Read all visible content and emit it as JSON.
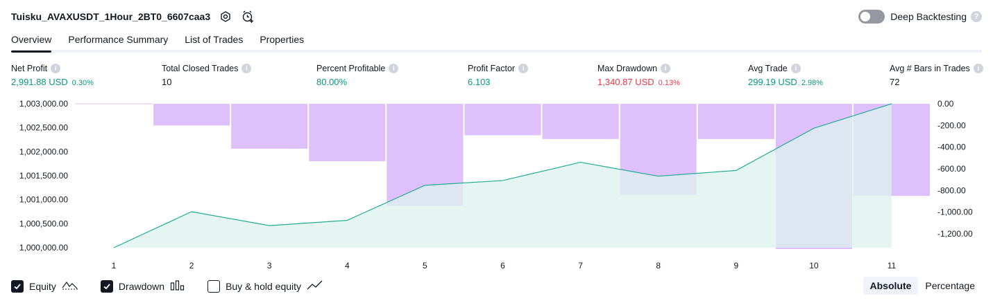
{
  "header": {
    "title": "Tuisku_AVAXUSDT_1Hour_2BT0_6607caa3",
    "deep_backtesting_label": "Deep Backtesting",
    "deep_backtesting_enabled": false,
    "help_glyph": "?"
  },
  "tabs": [
    {
      "label": "Overview",
      "active": true
    },
    {
      "label": "Performance Summary",
      "active": false
    },
    {
      "label": "List of Trades",
      "active": false
    },
    {
      "label": "Properties",
      "active": false
    }
  ],
  "metrics": [
    {
      "label": "Net Profit",
      "value": "2,991.88 USD",
      "pct": "0.30%",
      "color": "green"
    },
    {
      "label": "Total Closed Trades",
      "value": "10",
      "pct": "",
      "color": "dark"
    },
    {
      "label": "Percent Profitable",
      "value": "80.00%",
      "pct": "",
      "color": "green"
    },
    {
      "label": "Profit Factor",
      "value": "6.103",
      "pct": "",
      "color": "green"
    },
    {
      "label": "Max Drawdown",
      "value": "1,340.87 USD",
      "pct": "0.13%",
      "color": "red"
    },
    {
      "label": "Avg Trade",
      "value": "299.19 USD",
      "pct": "2.98%",
      "color": "green"
    },
    {
      "label": "Avg # Bars in Trades",
      "value": "72",
      "pct": "",
      "color": "dark"
    }
  ],
  "info_glyph": "i",
  "chart_data": {
    "type": "area",
    "x": [
      1,
      2,
      3,
      4,
      5,
      6,
      7,
      8,
      9,
      10,
      11
    ],
    "series": [
      {
        "name": "Equity",
        "type": "area",
        "axis": "left",
        "values": [
          1000000,
          1000750,
          1000460,
          1000570,
          1001300,
          1001400,
          1001780,
          1001490,
          1001610,
          1002490,
          1003000
        ]
      },
      {
        "name": "Drawdown",
        "type": "bar",
        "axis": "right",
        "values": [
          0,
          -200,
          -415,
          -530,
          -940,
          -290,
          -325,
          -840,
          -325,
          -1340,
          -850
        ]
      }
    ],
    "left_ticks": [
      "1,003,000.00",
      "1,002,500.00",
      "1,002,000.00",
      "1,001,500.00",
      "1,001,000.00",
      "1,000,500.00",
      "1,000,000.00"
    ],
    "right_ticks": [
      "0.00",
      "-200.00",
      "-400.00",
      "-600.00",
      "-800.00",
      "-1,000.00",
      "-1,200.00"
    ],
    "left_ylim": [
      1000000,
      1003000
    ],
    "right_ylim": [
      -1340,
      0
    ],
    "colors": {
      "equity_line": "#22ab94",
      "equity_fill": "#dcf3ed",
      "drawdown_fill": "#d6b0fb",
      "drawdown_line": "#e5b8f0"
    }
  },
  "legend": {
    "equity": {
      "label": "Equity",
      "checked": true
    },
    "drawdown": {
      "label": "Drawdown",
      "checked": true
    },
    "buyhold": {
      "label": "Buy & hold equity",
      "checked": false
    }
  },
  "modes": {
    "absolute": "Absolute",
    "percentage": "Percentage",
    "active": "absolute"
  }
}
